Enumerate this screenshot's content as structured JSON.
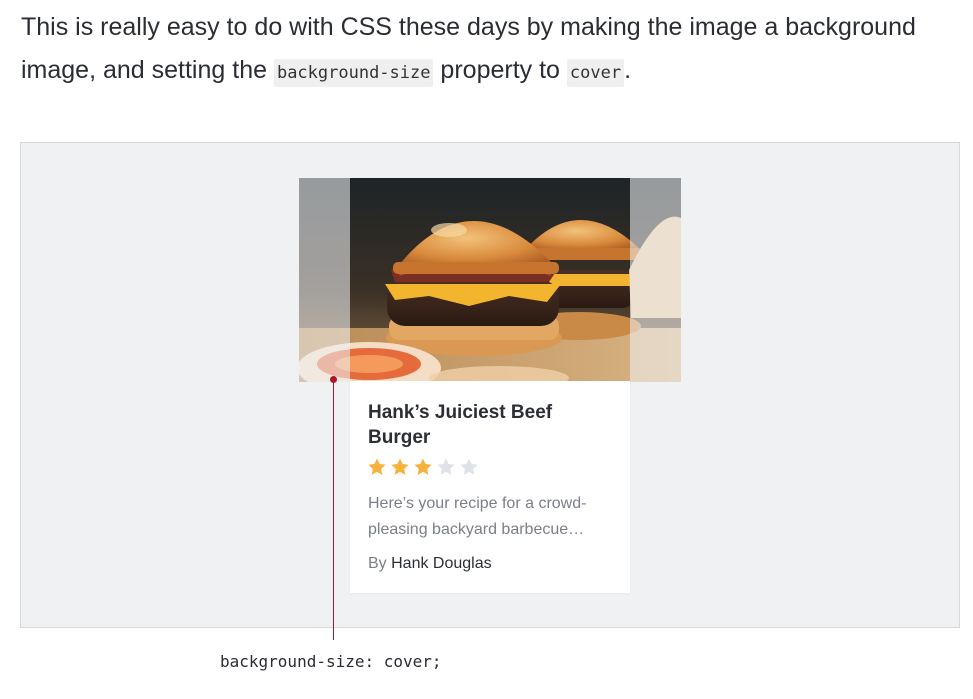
{
  "intro": {
    "text_before": "This is really easy to do with CSS these days by making the image a background image, and setting the ",
    "code_1": "background-size",
    "text_middle": " property to ",
    "code_2": "cover",
    "text_after": "."
  },
  "card": {
    "title": "Hank’s Juiciest Beef Burger",
    "rating": 3,
    "rating_max": 5,
    "description": "Here’s your recipe for a crowd-pleasing backyard barbecue…",
    "byline_prefix": "By ",
    "author": "Hank Douglas"
  },
  "caption": "background-size: cover;",
  "colors": {
    "star_filled": "#f6b23d",
    "star_empty": "#dfe2e6",
    "marker": "#b0152a",
    "demo_background": "#f0f1f3"
  }
}
